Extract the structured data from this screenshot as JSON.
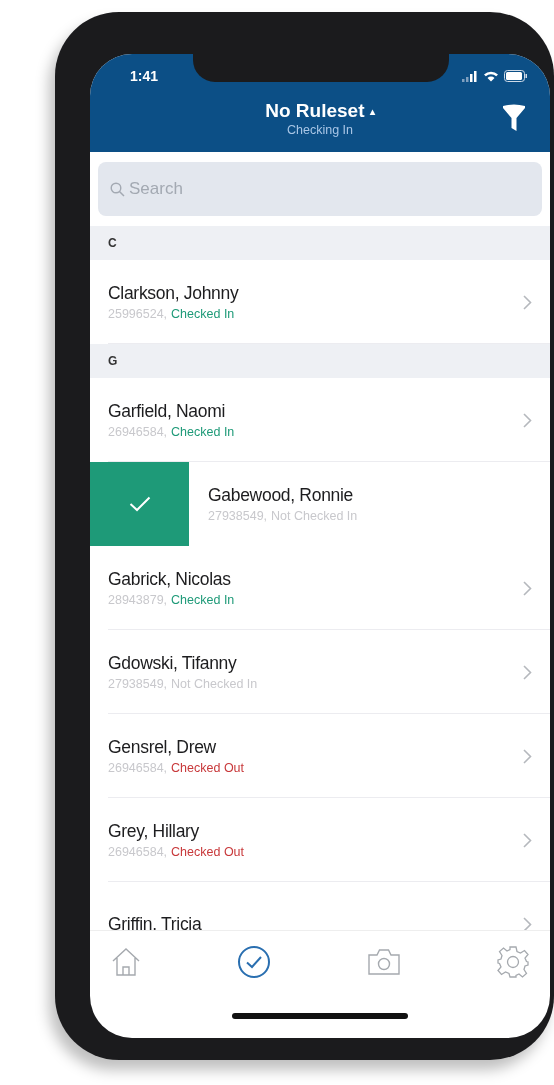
{
  "status_bar": {
    "time": "1:41"
  },
  "header": {
    "title": "No Ruleset",
    "title_caret": "▴",
    "subtitle": "Checking In"
  },
  "search": {
    "placeholder": "Search"
  },
  "sections": [
    {
      "letter": "C",
      "rows": [
        {
          "name": "Clarkson, Johnny",
          "id": "25996524,",
          "status": "Checked In",
          "kind": "checked_in",
          "swiped": false
        }
      ]
    },
    {
      "letter": "G",
      "rows": [
        {
          "name": "Garfield, Naomi",
          "id": "26946584,",
          "status": "Checked In",
          "kind": "checked_in",
          "swiped": false
        },
        {
          "name": "Gabewood, Ronnie",
          "id": "27938549,",
          "status": "Not Checked In",
          "kind": "not_checked_in",
          "swiped": true
        },
        {
          "name": "Gabrick, Nicolas",
          "id": "28943879,",
          "status": "Checked In",
          "kind": "checked_in",
          "swiped": false
        },
        {
          "name": "Gdowski, Tifanny",
          "id": "27938549,",
          "status": "Not Checked In",
          "kind": "not_checked_in",
          "swiped": false
        },
        {
          "name": "Gensrel, Drew",
          "id": "26946584,",
          "status": "Checked Out",
          "kind": "checked_out",
          "swiped": false
        },
        {
          "name": "Grey, Hillary",
          "id": "26946584,",
          "status": "Checked Out",
          "kind": "checked_out",
          "swiped": false
        },
        {
          "name": "Griffin. Tricia",
          "swiped": false
        }
      ]
    }
  ],
  "tab_bar": [
    {
      "selected": false
    },
    {
      "selected": true
    },
    {
      "selected": false
    },
    {
      "selected": false
    }
  ]
}
